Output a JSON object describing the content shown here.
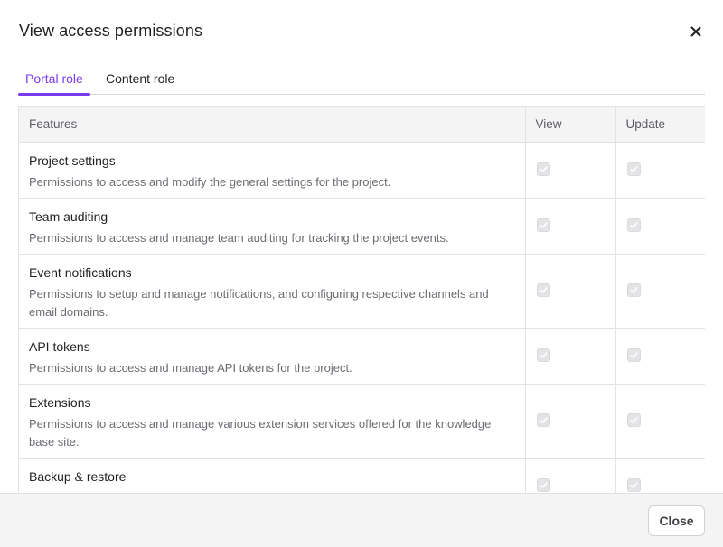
{
  "modal": {
    "title": "View access permissions",
    "close_button_label": "Close"
  },
  "tabs": [
    {
      "label": "Portal role",
      "active": true
    },
    {
      "label": "Content role",
      "active": false
    }
  ],
  "table": {
    "columns": [
      "Features",
      "View",
      "Update"
    ],
    "rows": [
      {
        "name": "Project settings",
        "description": "Permissions to access and modify the general settings for the project.",
        "view": true,
        "update": true
      },
      {
        "name": "Team auditing",
        "description": "Permissions to access and manage team auditing for tracking the project events.",
        "view": true,
        "update": true
      },
      {
        "name": "Event notifications",
        "description": "Permissions to setup and manage notifications, and configuring respective channels and email domains.",
        "view": true,
        "update": true
      },
      {
        "name": "API tokens",
        "description": "Permissions to access and manage API tokens for the project.",
        "view": true,
        "update": true
      },
      {
        "name": "Extensions",
        "description": "Permissions to access and manage various extension services offered for the knowledge base site.",
        "view": true,
        "update": true
      },
      {
        "name": "Backup & restore",
        "description": "",
        "view": true,
        "update": true
      }
    ]
  },
  "colors": {
    "accent": "#7c3aed",
    "footer_bg": "#f4f4f5",
    "disabled_checkbox": "#e4e4e7"
  },
  "icons": {
    "close": "close-icon",
    "checkbox": "check-icon"
  }
}
